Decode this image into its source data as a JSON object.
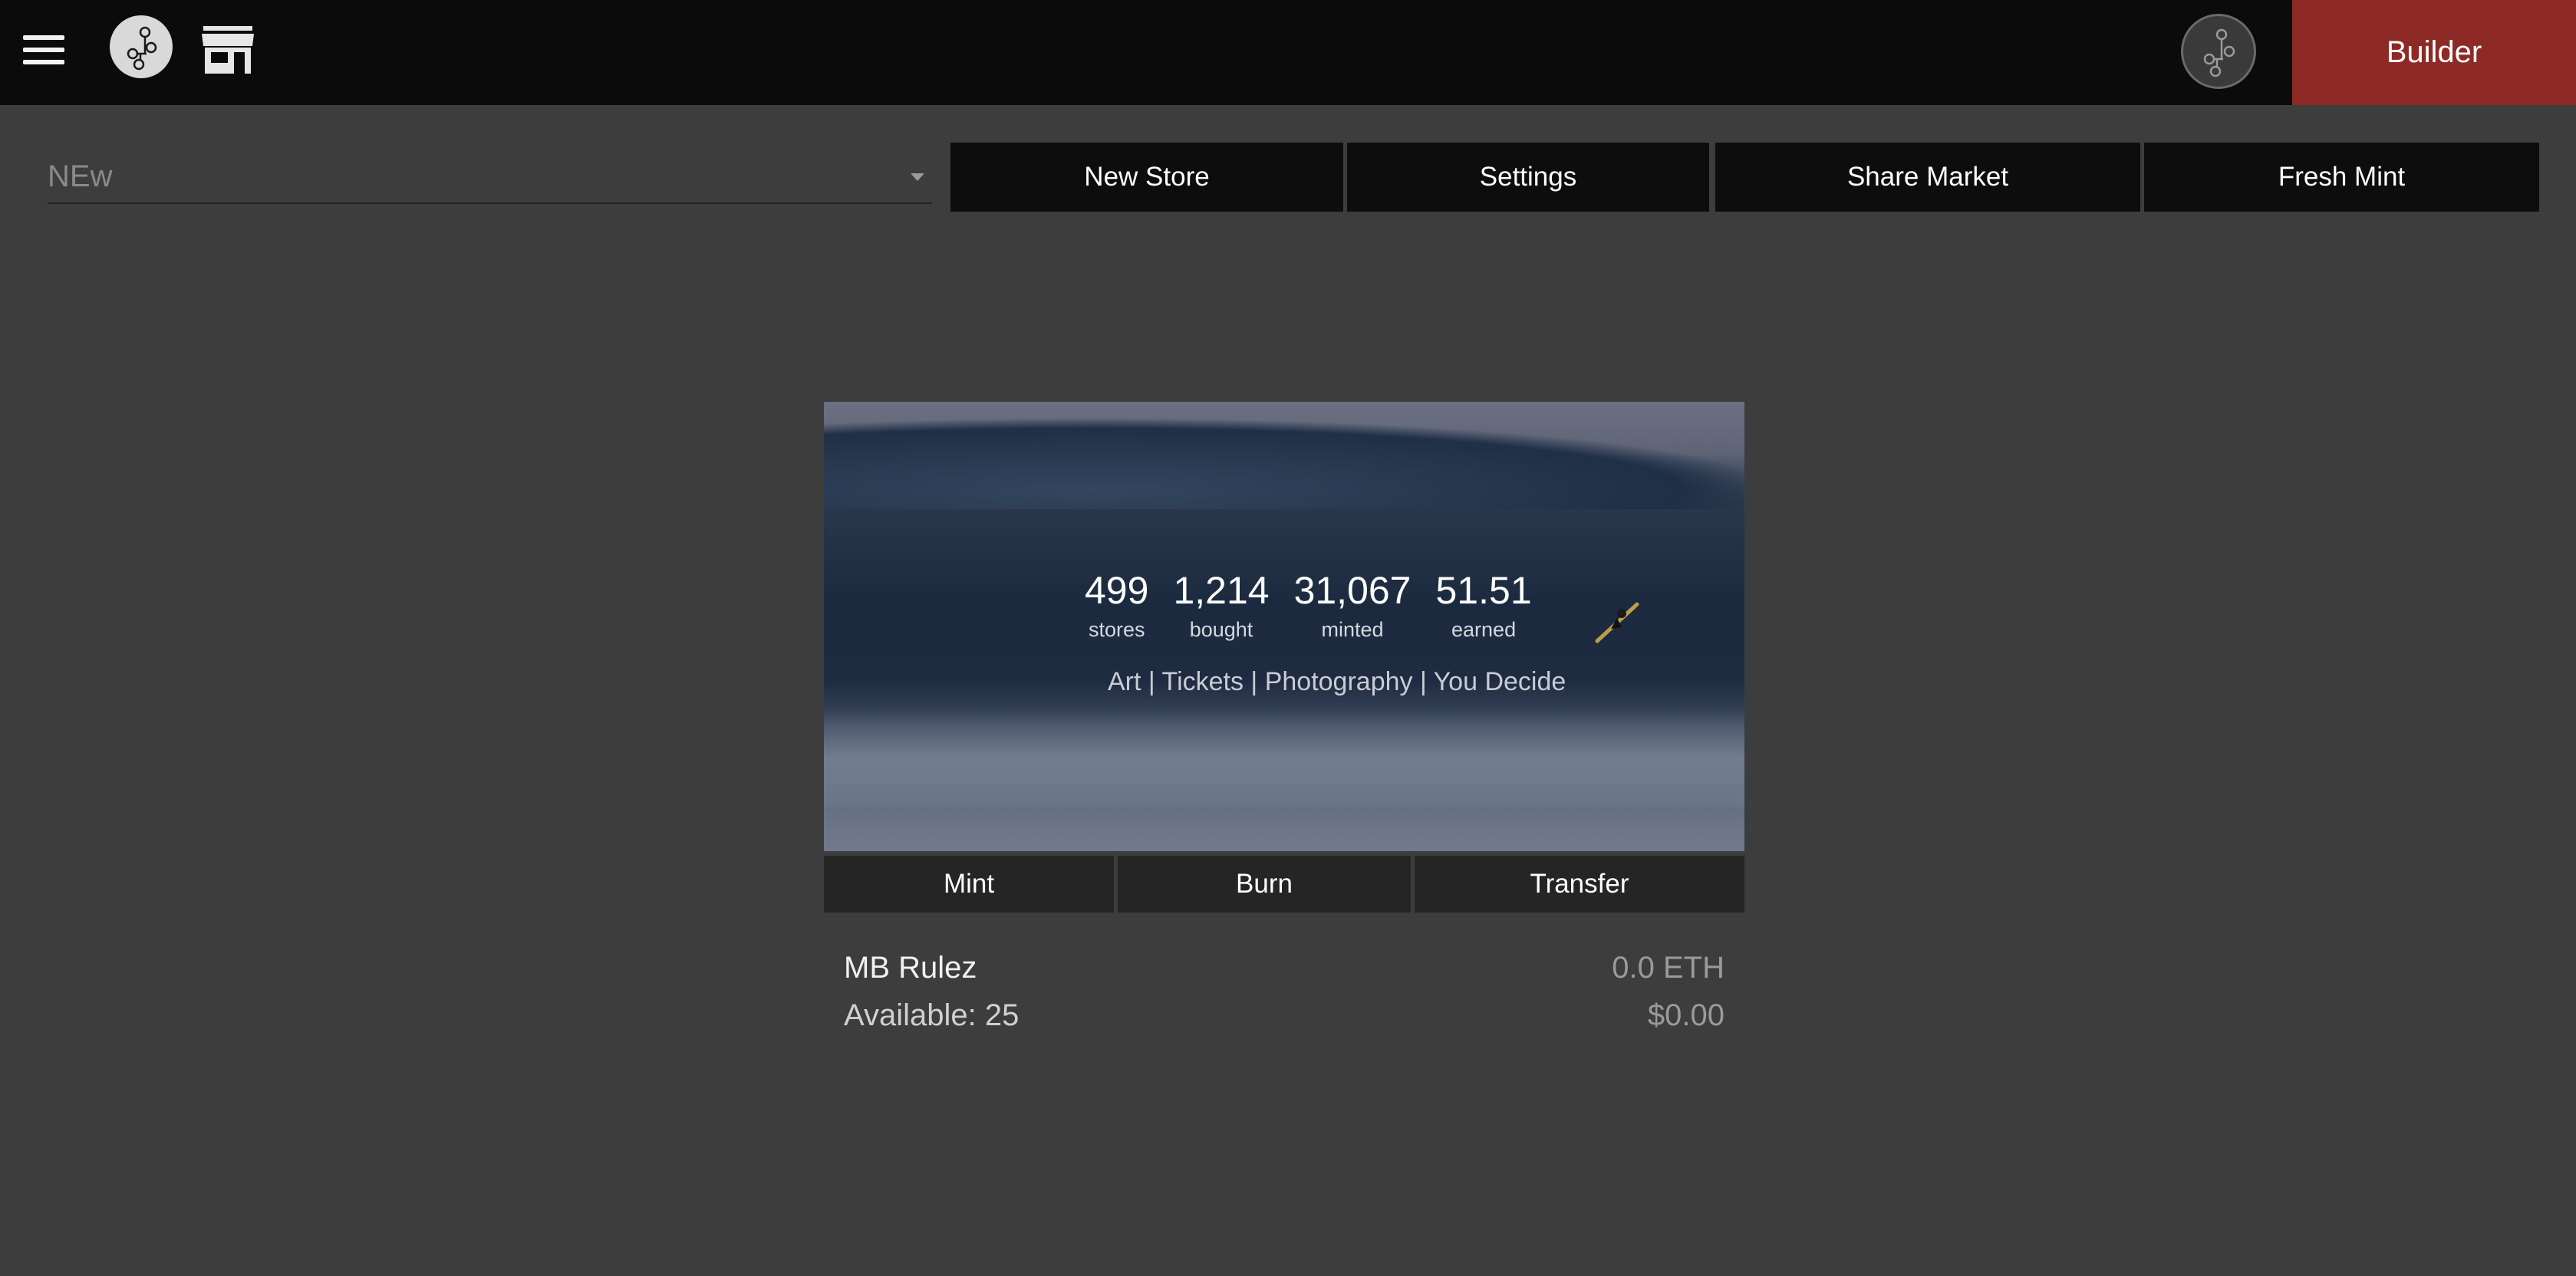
{
  "topbar": {
    "menu_icon": "hamburger-menu-icon",
    "logo_icon": "network-logo-icon",
    "store_icon": "storefront-icon",
    "avatar_icon": "network-avatar-icon",
    "builder_label": "Builder",
    "builder_color": "#8e2a25"
  },
  "toolbar": {
    "store_select_value": "NEw",
    "buttons": [
      {
        "label": "New Store"
      },
      {
        "label": "Settings"
      },
      {
        "label": "Share Market"
      },
      {
        "label": "Fresh Mint"
      }
    ]
  },
  "card": {
    "stats": [
      {
        "value": "499",
        "label": "stores"
      },
      {
        "value": "1,214",
        "label": "bought"
      },
      {
        "value": "31,067",
        "label": "minted"
      },
      {
        "value": "51.51",
        "label": "earned"
      }
    ],
    "tagline": "Art | Tickets | Photography | You Decide",
    "actions": [
      {
        "label": "Mint"
      },
      {
        "label": "Burn"
      },
      {
        "label": "Transfer"
      }
    ],
    "item": {
      "name": "MB Rulez",
      "available": "Available: 25",
      "price_eth": "0.0 ETH",
      "price_usd": "$0.00"
    }
  }
}
